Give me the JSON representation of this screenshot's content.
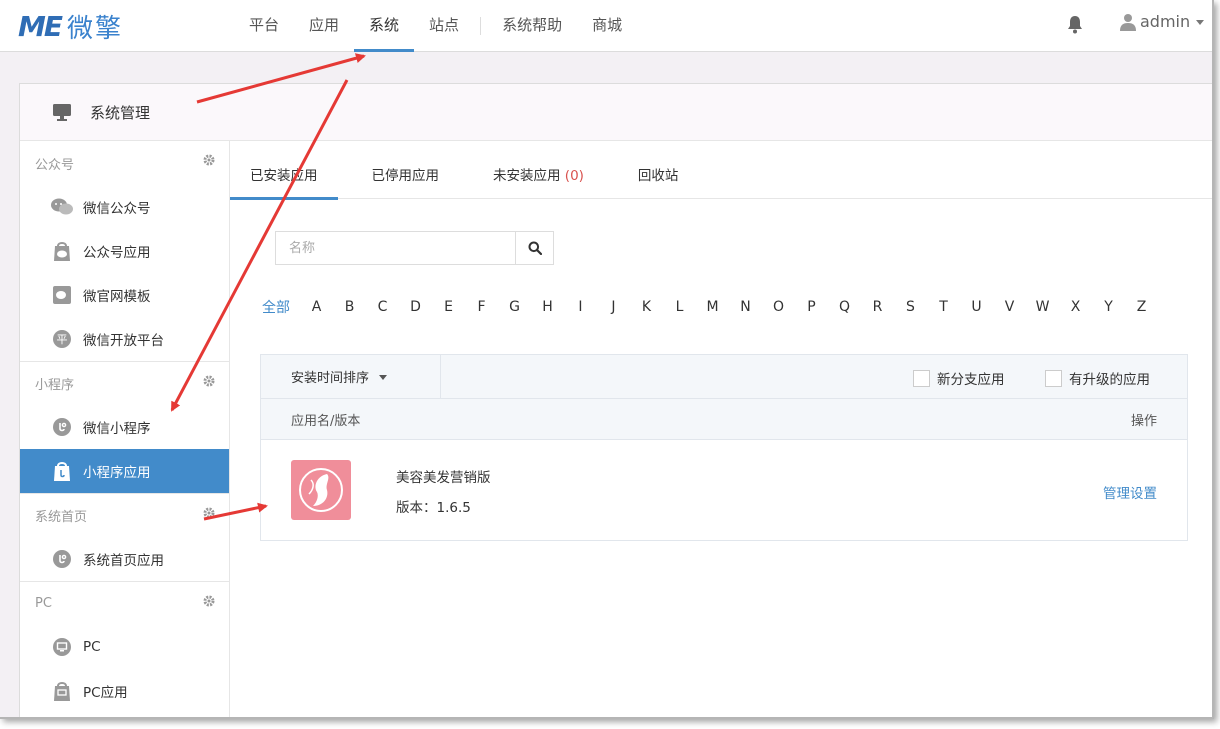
{
  "brand": {
    "mark": "ME",
    "name": "微擎"
  },
  "nav": [
    {
      "label": "平台"
    },
    {
      "label": "应用"
    },
    {
      "label": "系统",
      "active": true
    },
    {
      "label": "站点"
    },
    {
      "label": "系统帮助"
    },
    {
      "label": "商城"
    }
  ],
  "user": {
    "name": "admin"
  },
  "panel": {
    "title": "系统管理"
  },
  "sidebar": {
    "groups": [
      {
        "title": "公众号",
        "items": [
          {
            "label": "微信公众号",
            "icon": "wechat-icon"
          },
          {
            "label": "公众号应用",
            "icon": "bag-icon"
          },
          {
            "label": "微官网模板",
            "icon": "template-icon"
          },
          {
            "label": "微信开放平台",
            "icon": "platform-icon",
            "glyph": "平"
          }
        ]
      },
      {
        "title": "小程序",
        "items": [
          {
            "label": "微信小程序",
            "icon": "miniprogram-icon"
          },
          {
            "label": "小程序应用",
            "icon": "miniprogram-bag-icon",
            "active": true
          }
        ]
      },
      {
        "title": "系统首页",
        "items": [
          {
            "label": "系统首页应用",
            "icon": "miniprogram-icon"
          }
        ]
      },
      {
        "title": "PC",
        "items": [
          {
            "label": "PC",
            "icon": "pc-icon"
          },
          {
            "label": "PC应用",
            "icon": "pc-bag-icon"
          }
        ]
      }
    ]
  },
  "tabs": {
    "installed": "已安装应用",
    "disabled": "已停用应用",
    "uninstalled": "未安装应用",
    "uninstalled_count": "(0)",
    "recycle": "回收站"
  },
  "search": {
    "placeholder": "名称"
  },
  "letters": {
    "all": "全部",
    "items": [
      "A",
      "B",
      "C",
      "D",
      "E",
      "F",
      "G",
      "H",
      "I",
      "J",
      "K",
      "L",
      "M",
      "N",
      "O",
      "P",
      "Q",
      "R",
      "S",
      "T",
      "U",
      "V",
      "W",
      "X",
      "Y",
      "Z"
    ]
  },
  "list": {
    "sort_label": "安装时间排序",
    "filter_new_branch": "新分支应用",
    "filter_upgradable": "有升级的应用",
    "col_name": "应用名/版本",
    "col_action": "操作",
    "rows": [
      {
        "name": "美容美发营销版",
        "version": "版本：1.6.5",
        "action": "管理设置"
      }
    ]
  },
  "colors": {
    "accent": "#428bca",
    "annotation": "#e53935",
    "app_icon_bg": "#f08e9a"
  }
}
